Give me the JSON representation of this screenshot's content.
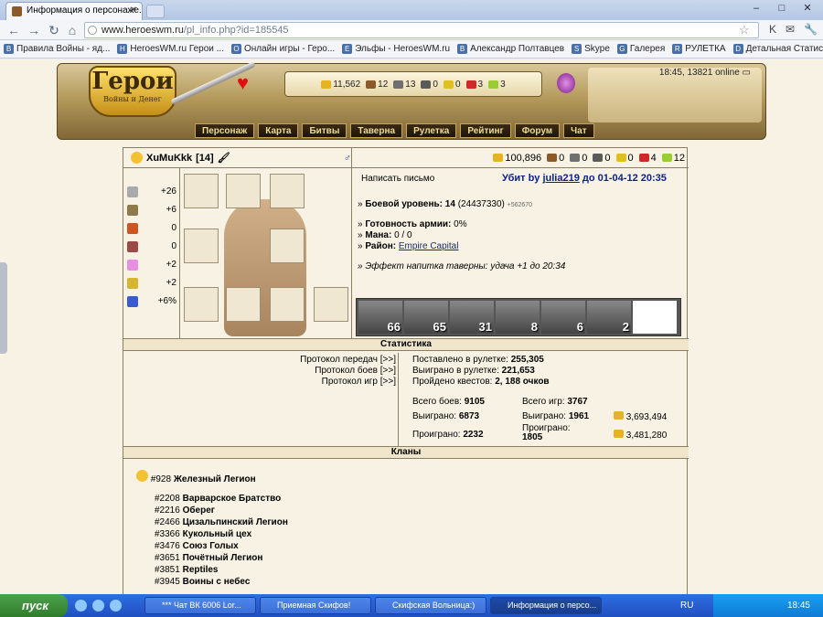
{
  "browser": {
    "tab_title": "Информация о персонаже.",
    "url_host": "www.heroeswm.ru",
    "url_path": "/pl_info.php?id=185545",
    "bookmarks": [
      {
        "icon": "B",
        "label": "Правила Войны - яд..."
      },
      {
        "icon": "H",
        "label": "HeroesWM.ru Герои ..."
      },
      {
        "icon": "O",
        "label": "Онлайн игры - Геро..."
      },
      {
        "icon": "E",
        "label": "Эльфы - HeroesWM.ru"
      },
      {
        "icon": "B",
        "label": "Александр Полтавцев"
      },
      {
        "icon": "S",
        "label": "Skype"
      },
      {
        "icon": "G",
        "label": "Галерея"
      },
      {
        "icon": "R",
        "label": "РУЛЕТКА"
      },
      {
        "icon": "D",
        "label": "Детальная Статист..."
      }
    ]
  },
  "header": {
    "logo_text": "Герои",
    "logo_sub": "Войны и Денег",
    "clock": "18:45, 13821 online",
    "resources": [
      "11,562",
      "12",
      "13",
      "0",
      "0",
      "3",
      "3"
    ],
    "menu": [
      "Персонаж",
      "Карта",
      "Битвы",
      "Таверна",
      "Рулетка",
      "Рейтинг",
      "Форум",
      "Чат"
    ]
  },
  "character": {
    "name": "XuMuKkk",
    "level_badge": "[14]",
    "resources": [
      "100,896",
      "0",
      "0",
      "0",
      "0",
      "4",
      "12"
    ],
    "stats": [
      {
        "icon": "swords-icon",
        "value": "+26"
      },
      {
        "icon": "shield-icon",
        "value": "+6"
      },
      {
        "icon": "wand-icon",
        "value": "0"
      },
      {
        "icon": "book-icon",
        "value": "0"
      },
      {
        "icon": "rainbow-icon",
        "value": "+2"
      },
      {
        "icon": "wings-icon",
        "value": "+2"
      },
      {
        "icon": "gem-icon",
        "value": "+6%"
      }
    ],
    "write_letter": "Написать письмо",
    "killed_by_label": "Убит by",
    "killed_by_name": "julia219",
    "killed_until": "до 01-04-12 20:35",
    "combat_level_label": "Боевой уровень:",
    "combat_level": "14",
    "combat_exp": "(24437330)",
    "combat_exp_small": "+562670",
    "army_ready_label": "Готовность армии:",
    "army_ready": "0%",
    "mana_label": "Мана:",
    "mana": "0 / 0",
    "district_label": "Район:",
    "district": "Empire Capital",
    "tavern_effect": "Эффект напитка таверны: удача +1 до 20:34",
    "army": [
      "66",
      "65",
      "31",
      "8",
      "6",
      "2",
      ""
    ]
  },
  "statistics": {
    "title": "Статистика",
    "protocols": [
      "Протокол передач [>>]",
      "Протокол боев [>>]",
      "Протокол игр [>>]"
    ],
    "roulette_bet_label": "Поставлено в рулетке:",
    "roulette_bet": "255,305",
    "roulette_won_label": "Выиграно в рулетке:",
    "roulette_won": "221,653",
    "quests_label": "Пройдено квестов:",
    "quests": "2, 188 очков",
    "total_battles_label": "Всего боев:",
    "total_battles": "9105",
    "total_games_label": "Всего игр:",
    "total_games": "3767",
    "won_label": "Выиграно:",
    "won_battles": "6873",
    "won_games": "1961",
    "won_gold": "3,693,494",
    "lost_label": "Проиграно:",
    "lost_battles": "2232",
    "lost_games": "1805",
    "lost_gold": "3,481,280"
  },
  "clans": {
    "title": "Кланы",
    "main": {
      "num": "#928",
      "name": "Железный Легион"
    },
    "list": [
      {
        "num": "#2208",
        "name": "Варварское Братство"
      },
      {
        "num": "#2216",
        "name": "Оберег"
      },
      {
        "num": "#2466",
        "name": "Цизальпинский Легион"
      },
      {
        "num": "#3366",
        "name": "Кукольный цех"
      },
      {
        "num": "#3476",
        "name": "Союз Голых"
      },
      {
        "num": "#3651",
        "name": "Почётный Легион"
      },
      {
        "num": "#3851",
        "name": "Reptiles"
      },
      {
        "num": "#3945",
        "name": "Воины с небес"
      }
    ]
  },
  "taskbar": {
    "start": "пуск",
    "windows": [
      "*** Чат ВК 6006 Lor...",
      "Приемная Скифов!",
      "Скифская Вольница:)",
      "Информация о персо..."
    ],
    "lang": "RU",
    "time": "18:45"
  }
}
